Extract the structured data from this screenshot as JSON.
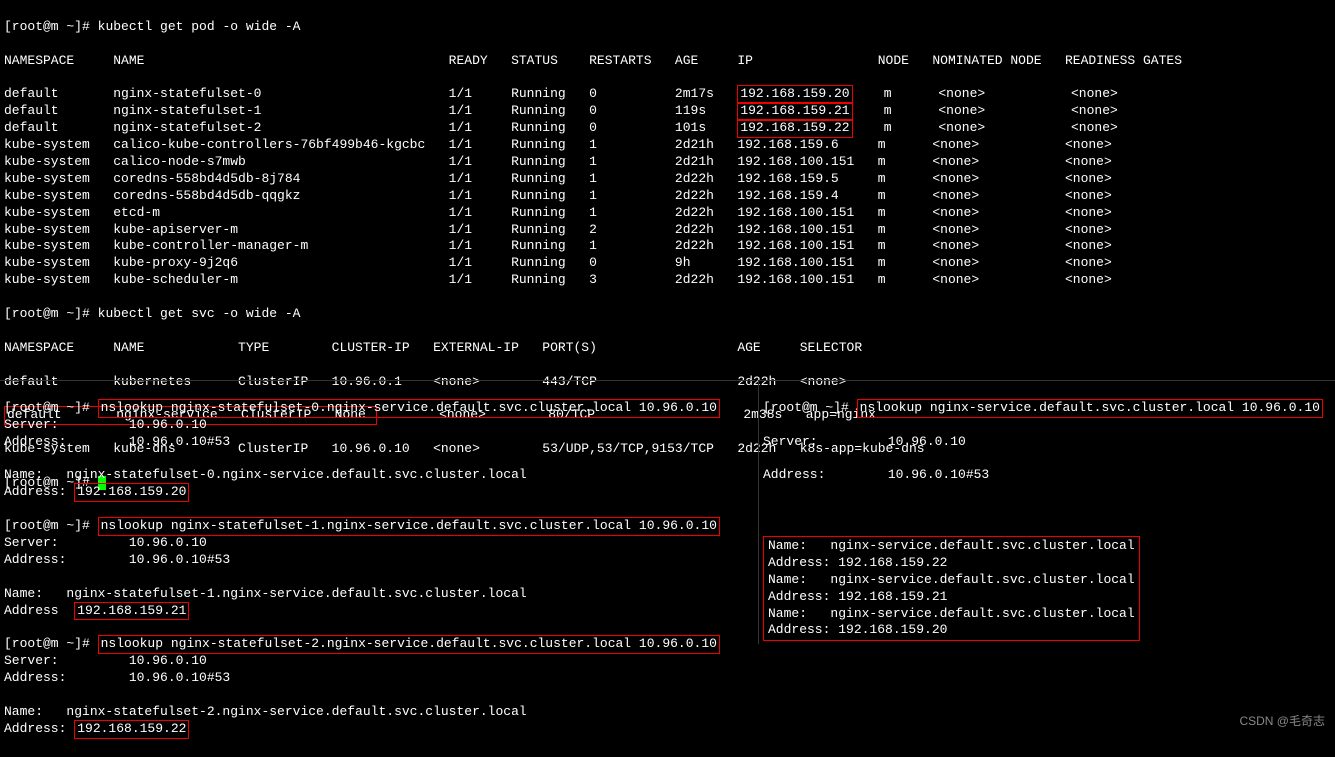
{
  "top": {
    "prompt": "[root@m ~]#",
    "cmd1": "kubectl get pod -o wide -A",
    "pod_header": "NAMESPACE     NAME                                       READY   STATUS    RESTARTS   AGE     IP                NODE   NOMINATED NODE   READINESS GATES",
    "pods": [
      {
        "pre": "default       nginx-statefulset-0                        1/1     Running   0          2m17s   ",
        "ip": "192.168.159.20",
        "post": "    m      <none>           <none>"
      },
      {
        "pre": "default       nginx-statefulset-1                        1/1     Running   0          119s    ",
        "ip": "192.168.159.21",
        "post": "    m      <none>           <none>"
      },
      {
        "pre": "default       nginx-statefulset-2                        1/1     Running   0          101s    ",
        "ip": "192.168.159.22",
        "post": "    m      <none>           <none>"
      },
      {
        "pre": "kube-system   calico-kube-controllers-76bf499b46-kgcbc   1/1     Running   1          2d21h   192.168.159.6     m      <none>           <none>",
        "ip": "",
        "post": ""
      },
      {
        "pre": "kube-system   calico-node-s7mwb                          1/1     Running   1          2d21h   192.168.100.151   m      <none>           <none>",
        "ip": "",
        "post": ""
      },
      {
        "pre": "kube-system   coredns-558bd4d5db-8j784                   1/1     Running   1          2d22h   192.168.159.5     m      <none>           <none>",
        "ip": "",
        "post": ""
      },
      {
        "pre": "kube-system   coredns-558bd4d5db-qqgkz                   1/1     Running   1          2d22h   192.168.159.4     m      <none>           <none>",
        "ip": "",
        "post": ""
      },
      {
        "pre": "kube-system   etcd-m                                     1/1     Running   1          2d22h   192.168.100.151   m      <none>           <none>",
        "ip": "",
        "post": ""
      },
      {
        "pre": "kube-system   kube-apiserver-m                           1/1     Running   2          2d22h   192.168.100.151   m      <none>           <none>",
        "ip": "",
        "post": ""
      },
      {
        "pre": "kube-system   kube-controller-manager-m                  1/1     Running   1          2d22h   192.168.100.151   m      <none>           <none>",
        "ip": "",
        "post": ""
      },
      {
        "pre": "kube-system   kube-proxy-9j2q6                           1/1     Running   0          9h      192.168.100.151   m      <none>           <none>",
        "ip": "",
        "post": ""
      },
      {
        "pre": "kube-system   kube-scheduler-m                           1/1     Running   3          2d22h   192.168.100.151   m      <none>           <none>",
        "ip": "",
        "post": ""
      }
    ],
    "cmd2": "kubectl get svc -o wide -A",
    "svc_header": "NAMESPACE     NAME            TYPE        CLUSTER-IP   EXTERNAL-IP   PORT(S)                  AGE     SELECTOR",
    "svc1": "default       kubernetes      ClusterIP   10.96.0.1    <none>        443/TCP                  2d22h   <none>",
    "svc2_hl": "default       nginx-service   ClusterIP   None ",
    "svc2_rest": "        <none>        80/TCP                   2m38s   app=nginx",
    "svc3": "kube-system   kube-dns        ClusterIP   10.96.0.10   <none>        53/UDP,53/TCP,9153/TCP   2d22h   k8s-app=kube-dns"
  },
  "left": {
    "prompt": "[root@m ~]#",
    "lookups": [
      {
        "cmd": "nslookup nginx-statefulset-0.nginx-service.default.svc.cluster.local 10.96.0.10",
        "server": "Server:         10.96.0.10",
        "address_srv": "Address:        10.96.0.10#53",
        "name": "Name:   nginx-statefulset-0.nginx-service.default.svc.cluster.local",
        "addr_pre": "Address: ",
        "addr_ip": "192.168.159.20"
      },
      {
        "cmd": "nslookup nginx-statefulset-1.nginx-service.default.svc.cluster.local 10.96.0.10",
        "server": "Server:         10.96.0.10",
        "address_srv": "Address:        10.96.0.10#53",
        "name": "Name:   nginx-statefulset-1.nginx-service.default.svc.cluster.local",
        "addr_pre": "Address  ",
        "addr_ip": "192.168.159.21"
      },
      {
        "cmd": "nslookup nginx-statefulset-2.nginx-service.default.svc.cluster.local 10.96.0.10",
        "server": "Server:         10.96.0.10",
        "address_srv": "Address:        10.96.0.10#53",
        "name": "Name:   nginx-statefulset-2.nginx-service.default.svc.cluster.local",
        "addr_pre": "Address: ",
        "addr_ip": "192.168.159.22"
      }
    ]
  },
  "right": {
    "prompt": "[root@m ~]#",
    "cmd": "nslookup nginx-service.default.svc.cluster.local 10.96.0.10",
    "server": "Server:         10.96.0.10",
    "address_srv": "Address:        10.96.0.10#53",
    "results": [
      "Name:   nginx-service.default.svc.cluster.local",
      "Address: 192.168.159.22",
      "Name:   nginx-service.default.svc.cluster.local",
      "Address: 192.168.159.21",
      "Name:   nginx-service.default.svc.cluster.local",
      "Address: 192.168.159.20"
    ]
  },
  "watermark": "CSDN @毛奇志"
}
